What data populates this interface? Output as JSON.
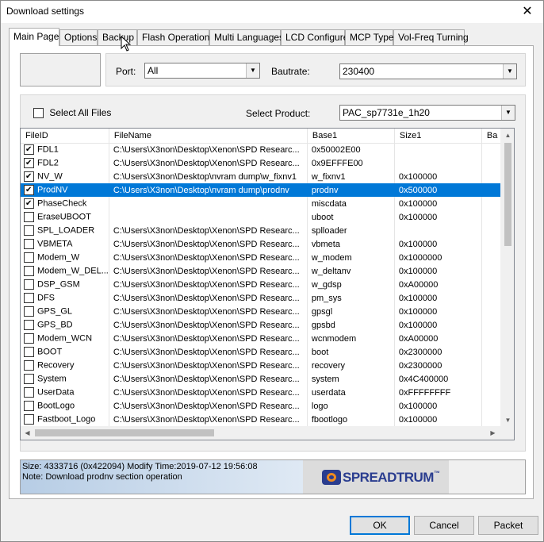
{
  "window": {
    "title": "Download settings",
    "close_glyph": "✕"
  },
  "tabs": [
    {
      "label": "Main Page",
      "active": true
    },
    {
      "label": "Options"
    },
    {
      "label": "Backup"
    },
    {
      "label": "Flash Operations"
    },
    {
      "label": "Multi Languages"
    },
    {
      "label": "LCD Configure"
    },
    {
      "label": "MCP Type"
    },
    {
      "label": "Vol-Freq Turning"
    }
  ],
  "port": {
    "label": "Port:",
    "value": "All"
  },
  "baudrate": {
    "label": "Bautrate:",
    "value": "230400"
  },
  "select_all": {
    "label": "Select All Files",
    "checked": false
  },
  "product": {
    "label": "Select Product:",
    "value": "PAC_sp7731e_1h20"
  },
  "table": {
    "columns": [
      "FileID",
      "FileName",
      "Base1",
      "Size1",
      "Ba"
    ],
    "rows": [
      {
        "checked": true,
        "id": "FDL1",
        "file": "C:\\Users\\X3non\\Desktop\\Xenon\\SPD Researc...",
        "base": "0x50002E00",
        "size": ""
      },
      {
        "checked": true,
        "id": "FDL2",
        "file": "C:\\Users\\X3non\\Desktop\\Xenon\\SPD Researc...",
        "base": "0x9EFFFE00",
        "size": ""
      },
      {
        "checked": true,
        "id": "NV_W",
        "file": "C:\\Users\\X3non\\Desktop\\nvram dump\\w_fixnv1",
        "base": "w_fixnv1",
        "size": "0x100000"
      },
      {
        "checked": true,
        "id": "ProdNV",
        "file": "C:\\Users\\X3non\\Desktop\\nvram dump\\prodnv",
        "base": "prodnv",
        "size": "0x500000",
        "selected": true
      },
      {
        "checked": true,
        "id": "PhaseCheck",
        "file": "",
        "base": "miscdata",
        "size": "0x100000"
      },
      {
        "checked": false,
        "id": "EraseUBOOT",
        "file": "",
        "base": "uboot",
        "size": "0x100000"
      },
      {
        "checked": false,
        "id": "SPL_LOADER",
        "file": "C:\\Users\\X3non\\Desktop\\Xenon\\SPD Researc...",
        "base": "splloader",
        "size": ""
      },
      {
        "checked": false,
        "id": "VBMETA",
        "file": "C:\\Users\\X3non\\Desktop\\Xenon\\SPD Researc...",
        "base": "vbmeta",
        "size": "0x100000"
      },
      {
        "checked": false,
        "id": "Modem_W",
        "file": "C:\\Users\\X3non\\Desktop\\Xenon\\SPD Researc...",
        "base": "w_modem",
        "size": "0x1000000"
      },
      {
        "checked": false,
        "id": "Modem_W_DEL...",
        "file": "C:\\Users\\X3non\\Desktop\\Xenon\\SPD Researc...",
        "base": "w_deltanv",
        "size": "0x100000"
      },
      {
        "checked": false,
        "id": "DSP_GSM",
        "file": "C:\\Users\\X3non\\Desktop\\Xenon\\SPD Researc...",
        "base": "w_gdsp",
        "size": "0xA00000"
      },
      {
        "checked": false,
        "id": "DFS",
        "file": "C:\\Users\\X3non\\Desktop\\Xenon\\SPD Researc...",
        "base": "pm_sys",
        "size": "0x100000"
      },
      {
        "checked": false,
        "id": "GPS_GL",
        "file": "C:\\Users\\X3non\\Desktop\\Xenon\\SPD Researc...",
        "base": "gpsgl",
        "size": "0x100000"
      },
      {
        "checked": false,
        "id": "GPS_BD",
        "file": "C:\\Users\\X3non\\Desktop\\Xenon\\SPD Researc...",
        "base": "gpsbd",
        "size": "0x100000"
      },
      {
        "checked": false,
        "id": "Modem_WCN",
        "file": "C:\\Users\\X3non\\Desktop\\Xenon\\SPD Researc...",
        "base": "wcnmodem",
        "size": "0xA00000"
      },
      {
        "checked": false,
        "id": "BOOT",
        "file": "C:\\Users\\X3non\\Desktop\\Xenon\\SPD Researc...",
        "base": "boot",
        "size": "0x2300000"
      },
      {
        "checked": false,
        "id": "Recovery",
        "file": "C:\\Users\\X3non\\Desktop\\Xenon\\SPD Researc...",
        "base": "recovery",
        "size": "0x2300000"
      },
      {
        "checked": false,
        "id": "System",
        "file": "C:\\Users\\X3non\\Desktop\\Xenon\\SPD Researc...",
        "base": "system",
        "size": "0x4C400000"
      },
      {
        "checked": false,
        "id": "UserData",
        "file": "C:\\Users\\X3non\\Desktop\\Xenon\\SPD Researc...",
        "base": "userdata",
        "size": "0xFFFFFFFF"
      },
      {
        "checked": false,
        "id": "BootLogo",
        "file": "C:\\Users\\X3non\\Desktop\\Xenon\\SPD Researc...",
        "base": "logo",
        "size": "0x100000"
      },
      {
        "checked": false,
        "id": "Fastboot_Logo",
        "file": "C:\\Users\\X3non\\Desktop\\Xenon\\SPD Researc...",
        "base": "fbootlogo",
        "size": "0x100000"
      }
    ]
  },
  "status": {
    "line1": "Size: 4333716  (0x422094) Modify Time:2019-07-12 19:56:08",
    "line2": "Note: Download prodnv section  operation"
  },
  "logo": {
    "text": "SPREADTRUM",
    "tm": "™"
  },
  "buttons": {
    "ok": "OK",
    "cancel": "Cancel",
    "packet": "Packet"
  },
  "colors": {
    "selection": "#0078d7",
    "brand": "#2a3d8f",
    "brand_accent": "#f08b1e"
  }
}
